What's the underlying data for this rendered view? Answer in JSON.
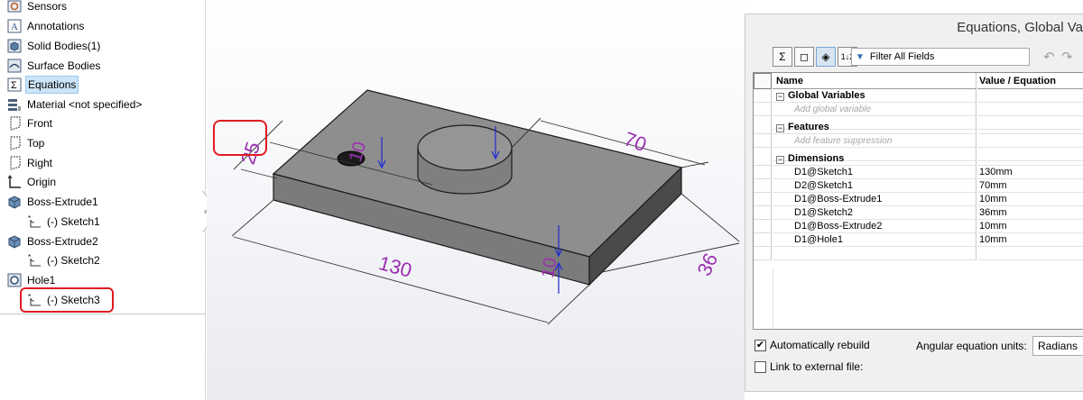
{
  "tree": {
    "items": [
      {
        "label": "Sensors",
        "icon": "sensor-icon"
      },
      {
        "label": "Annotations",
        "icon": "annotation-icon"
      },
      {
        "label": "Solid Bodies(1)",
        "icon": "solid-body-icon"
      },
      {
        "label": "Surface Bodies",
        "icon": "surface-body-icon"
      },
      {
        "label": "Equations",
        "icon": "sigma-icon"
      },
      {
        "label": "Material <not specified>",
        "icon": "material-icon"
      },
      {
        "label": "Front",
        "icon": "plane-icon"
      },
      {
        "label": "Top",
        "icon": "plane-icon"
      },
      {
        "label": "Right",
        "icon": "plane-icon"
      },
      {
        "label": "Origin",
        "icon": "origin-icon"
      },
      {
        "label": "Boss-Extrude1",
        "icon": "extrude-icon"
      },
      {
        "label": "(-) Sketch1",
        "icon": "sketch-icon"
      },
      {
        "label": "Boss-Extrude2",
        "icon": "extrude-icon"
      },
      {
        "label": "(-) Sketch2",
        "icon": "sketch-icon"
      },
      {
        "label": "Hole1",
        "icon": "hole-icon"
      },
      {
        "label": "(-) Sketch3",
        "icon": "sketch-icon"
      }
    ]
  },
  "viewport": {
    "dims": {
      "hole_dia": "10",
      "offset": "25",
      "length": "130",
      "width": "70",
      "thickness": "10",
      "boss_offset": "36"
    },
    "colors": {
      "part_face": "#8b8b8b",
      "dimension": "#9b2fb0",
      "annotation": "#1f2bd1",
      "highlight": "#e11b22"
    }
  },
  "dialog": {
    "title": "Equations, Global Va",
    "filter_placeholder": "Filter All Fields",
    "columns": {
      "name": "Name",
      "value": "Value / Equation"
    },
    "sections": {
      "global": "Global Variables",
      "features": "Features",
      "dimensions": "Dimensions"
    },
    "placeholders": {
      "global": "Add global variable",
      "features": "Add feature suppression"
    },
    "dimensions": [
      {
        "name": "D1@Sketch1",
        "value": "130mm"
      },
      {
        "name": "D2@Sketch1",
        "value": "70mm"
      },
      {
        "name": "D1@Boss-Extrude1",
        "value": "10mm"
      },
      {
        "name": "D1@Sketch2",
        "value": "36mm"
      },
      {
        "name": "D1@Boss-Extrude2",
        "value": "10mm"
      },
      {
        "name": "D1@Hole1",
        "value": "10mm"
      }
    ],
    "auto_rebuild": {
      "label": "Automatically rebuild",
      "checked": true
    },
    "link_external": {
      "label": "Link to external file:",
      "checked": false
    },
    "angular_label": "Angular equation units:",
    "angular_value": "Radians"
  }
}
